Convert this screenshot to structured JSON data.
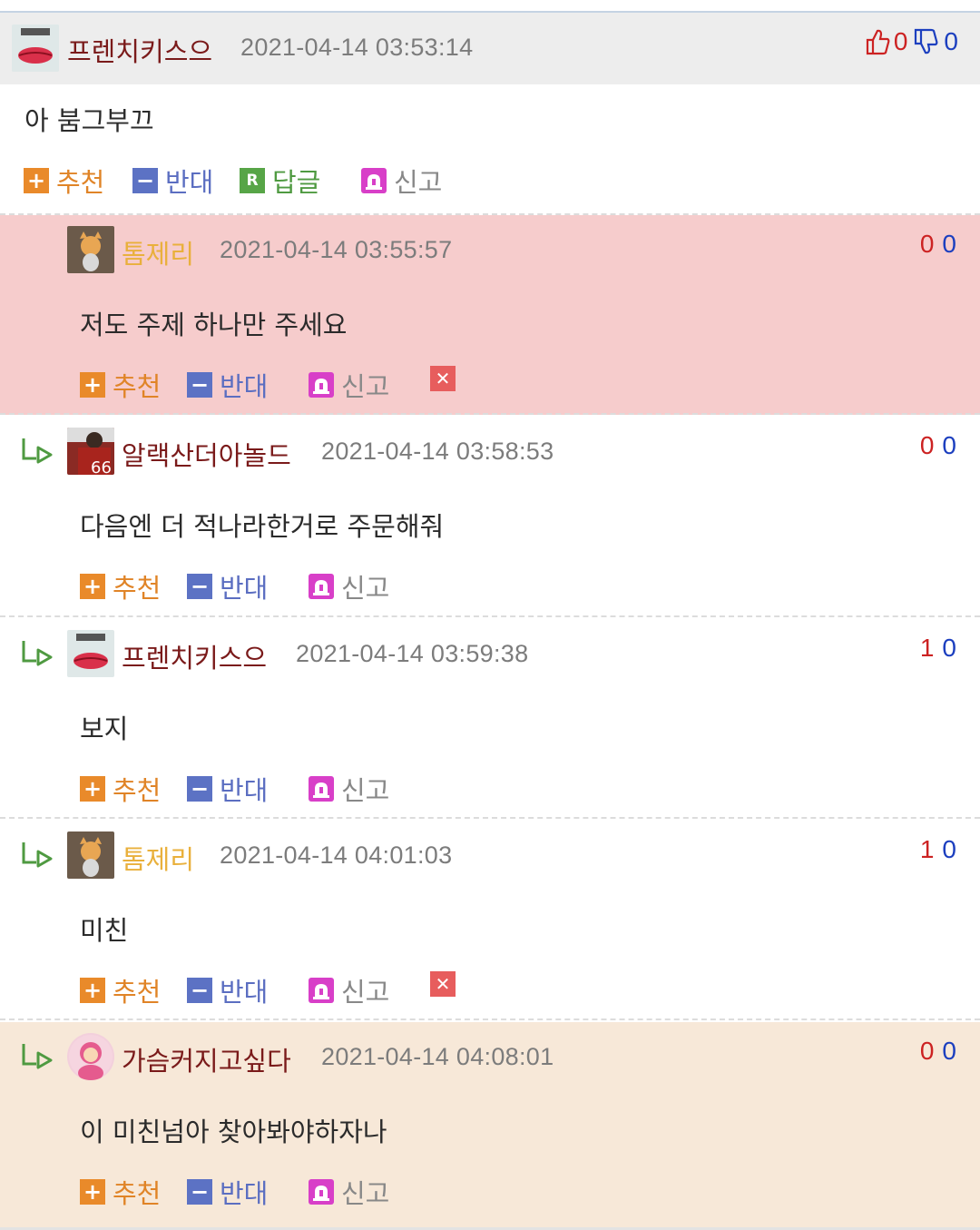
{
  "root": {
    "nick": "프렌치키스으",
    "date": "2021-04-14 03:53:14",
    "up": "0",
    "down": "0",
    "text": "아 붐그부끄",
    "actions": {
      "up": "추천",
      "down": "반대",
      "reply": "답글",
      "report": "신고"
    }
  },
  "replies": [
    {
      "nick": "톰제리",
      "date": "2021-04-14 03:55:57",
      "up": "0",
      "down": "0",
      "text": "저도 주제 하나만 주세요",
      "actions": {
        "up": "추천",
        "down": "반대",
        "report": "신고"
      },
      "bg": "#f6cccc",
      "nick_color": "#e9b03c",
      "deletable": true
    },
    {
      "nick": "알랙산더아놀드",
      "date": "2021-04-14 03:58:53",
      "up": "0",
      "down": "0",
      "text": "다음엔 더 적나라한거로 주문해줘",
      "actions": {
        "up": "추천",
        "down": "반대",
        "report": "신고"
      },
      "bg": "#ffffff",
      "nick_color": "#7a1a1a",
      "deletable": false
    },
    {
      "nick": "프렌치키스으",
      "date": "2021-04-14 03:59:38",
      "up": "1",
      "down": "0",
      "text": "보지",
      "actions": {
        "up": "추천",
        "down": "반대",
        "report": "신고"
      },
      "bg": "#ffffff",
      "nick_color": "#7a1a1a",
      "deletable": false
    },
    {
      "nick": "톰제리",
      "date": "2021-04-14 04:01:03",
      "up": "1",
      "down": "0",
      "text": "미친",
      "actions": {
        "up": "추천",
        "down": "반대",
        "report": "신고"
      },
      "bg": "#ffffff",
      "nick_color": "#e9b03c",
      "deletable": true
    },
    {
      "nick": "가슴커지고싶다",
      "date": "2021-04-14 04:08:01",
      "up": "0",
      "down": "0",
      "text": "이 미친넘아 찾아봐야하자나",
      "actions": {
        "up": "추천",
        "down": "반대",
        "report": "신고"
      },
      "bg": "#f7e8d8",
      "nick_color": "#7a1a1a",
      "deletable": false
    }
  ],
  "colors": {
    "up_vote": "#cc2222",
    "down_vote": "#1c3fbf",
    "root_header_bg": "#ededed"
  }
}
